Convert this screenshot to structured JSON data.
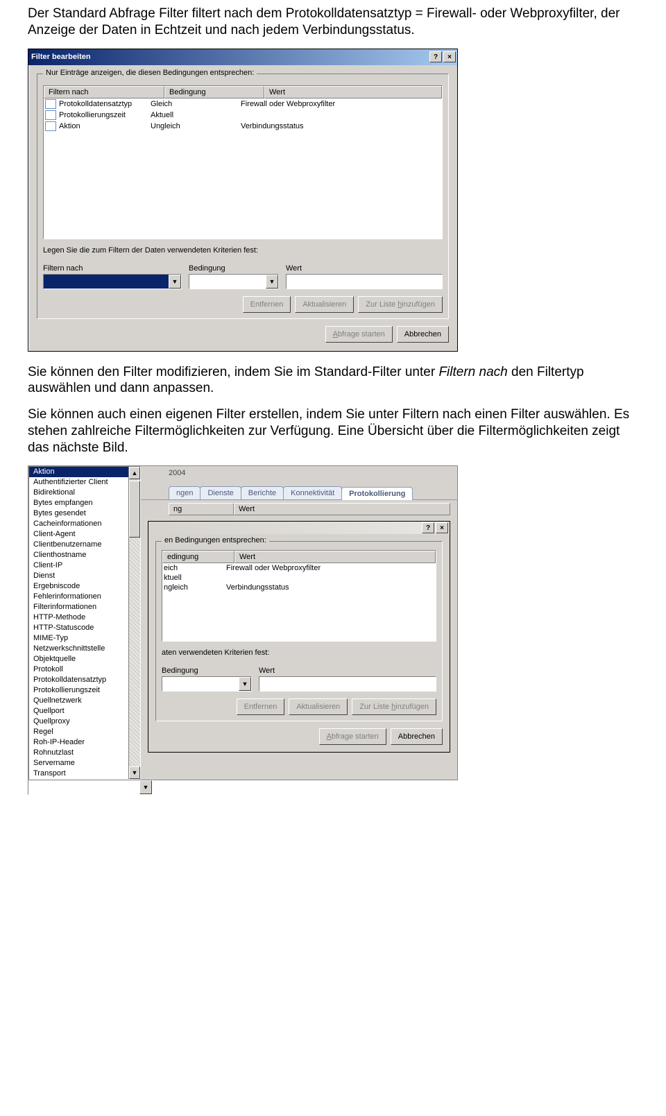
{
  "paragraphs": {
    "p1": "Der Standard Abfrage Filter filtert nach dem Protokolldatensatztyp = Firewall- oder Webproxyfilter, der Anzeige der Daten in Echtzeit und nach jedem Verbindungsstatus.",
    "p2_part1": "Sie können den Filter modifizieren, indem Sie im Standard-Filter unter ",
    "p2_italic1": "Filtern nach",
    "p2_part2": " den Filtertyp auswählen und dann anpassen.",
    "p3": "Sie können auch einen eigenen Filter erstellen, indem Sie unter Filtern nach einen Filter auswählen. Es stehen zahlreiche Filtermöglichkeiten zur Verfügung. Eine Übersicht über die Filtermöglichkeiten zeigt das nächste Bild."
  },
  "dialog": {
    "title": "Filter bearbeiten",
    "help_btn": "?",
    "close_btn": "×",
    "group_label": "Nur Einträge anzeigen, die diesen Bedingungen entsprechen:",
    "columns": {
      "filter": "Filtern nach",
      "cond": "Bedingung",
      "wert": "Wert"
    },
    "rows": [
      {
        "filter": "Protokolldatensatztyp",
        "cond": "Gleich",
        "wert": "Firewall oder Webproxyfilter"
      },
      {
        "filter": "Protokollierungszeit",
        "cond": "Aktuell",
        "wert": ""
      },
      {
        "filter": "Aktion",
        "cond": "Ungleich",
        "wert": "Verbindungsstatus"
      }
    ],
    "criteria_label": "Legen Sie die zum Filtern der Daten verwendeten Kriterien fest:",
    "criteria_headers": {
      "filter": "Filtern nach",
      "cond": "Bedingung",
      "wert": "Wert"
    },
    "buttons": {
      "remove": "Entfernen",
      "refresh": "Aktualisieren",
      "addlist": "Zur Liste hinzufügen",
      "start": "Abfrage starten",
      "cancel": "Abbrechen"
    }
  },
  "fig2": {
    "dropdown_items": [
      "Aktion",
      "Authentifizierter Client",
      "Bidirektional",
      "Bytes empfangen",
      "Bytes gesendet",
      "Cacheinformationen",
      "Client-Agent",
      "Clientbenutzername",
      "Clienthostname",
      "Client-IP",
      "Dienst",
      "Ergebniscode",
      "Fehlerinformationen",
      "Filterinformationen",
      "HTTP-Methode",
      "HTTP-Statuscode",
      "MIME-Typ",
      "Netzwerkschnittstelle",
      "Objektquelle",
      "Protokoll",
      "Protokolldatensatztyp",
      "Protokollierungszeit",
      "Quellnetzwerk",
      "Quellport",
      "Quellproxy",
      "Regel",
      "Roh-IP-Header",
      "Rohnutzlast",
      "Servername",
      "Transport"
    ],
    "year": "2004",
    "tabs": {
      "ngen": "ngen",
      "dienste": "Dienste",
      "berichte": "Berichte",
      "konnekt": "Konnektivität",
      "proto": "Protokollierung"
    },
    "partial": {
      "ng": "ng",
      "wert_hdr": "Wert",
      "group_frag": "en Bedingungen entsprechen:",
      "cond_frag": "edingung",
      "r1_cond": "eich",
      "r1_wert": "Firewall oder Webproxyfilter",
      "r2_cond": "ktuell",
      "r3_cond": "ngleich",
      "r3_wert": "Verbindungsstatus",
      "crit_frag": "aten verwendeten Kriterien fest:",
      "bed": "Bedingung",
      "wert": "Wert"
    },
    "buttons": {
      "remove": "Entfernen",
      "refresh": "Aktualisieren",
      "addlist": "Zur Liste hinzufügen",
      "start": "Abfrage starten",
      "cancel": "Abbrechen"
    }
  }
}
